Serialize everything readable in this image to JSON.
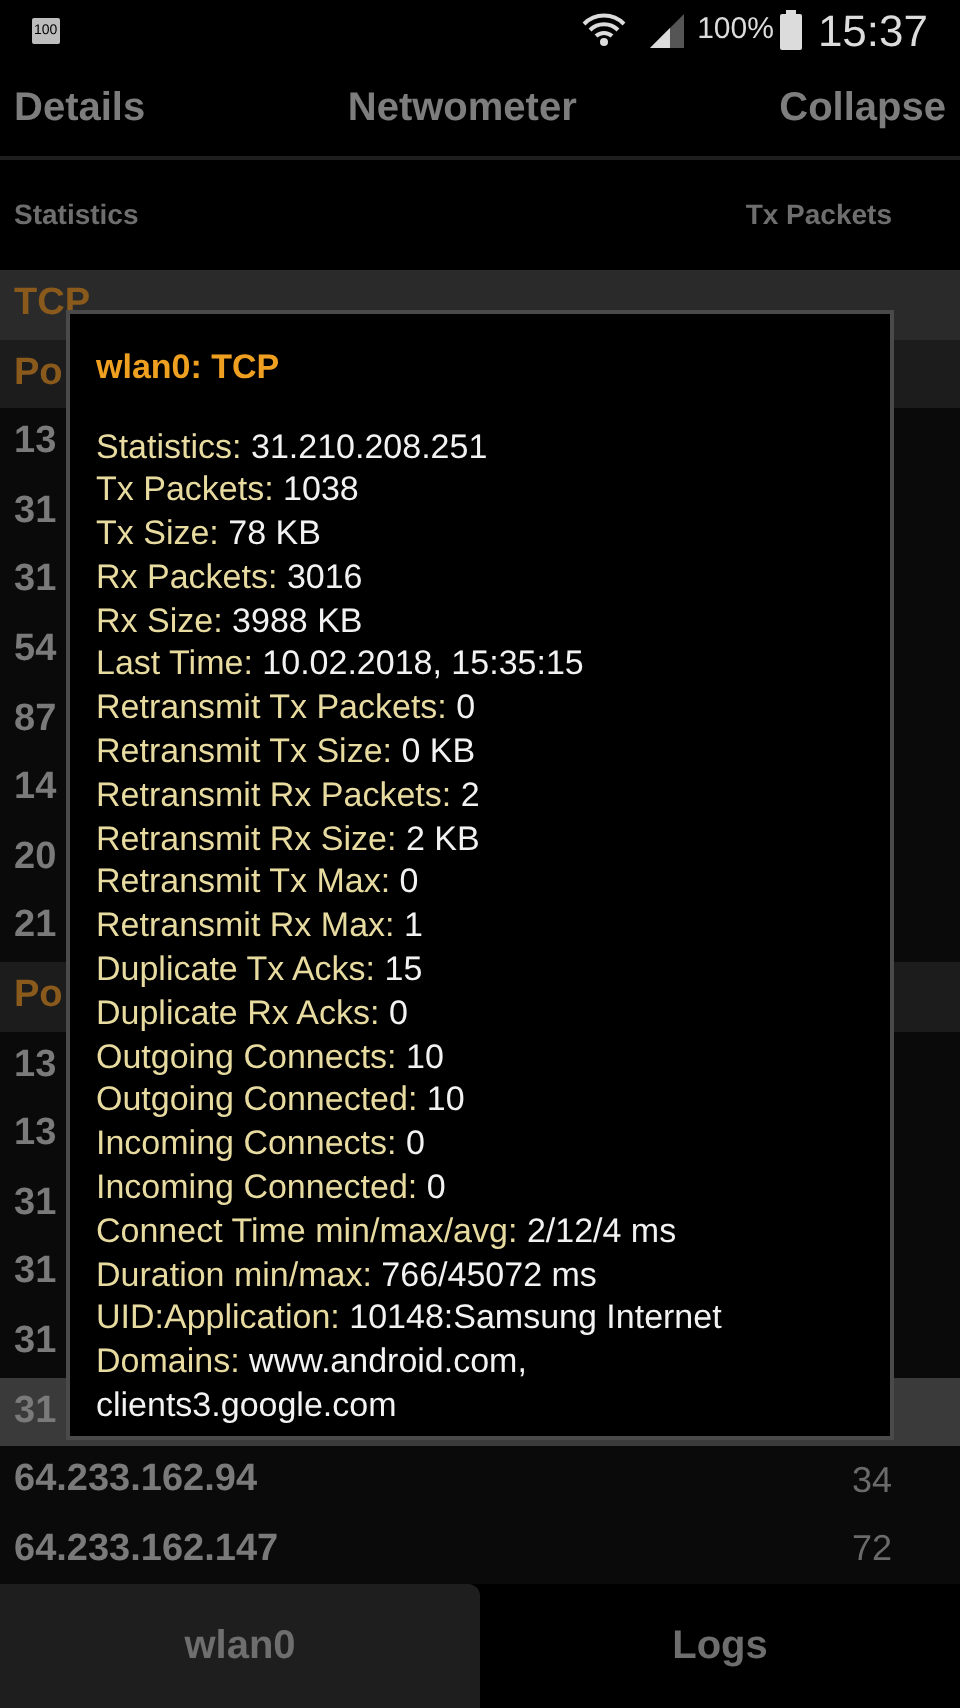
{
  "status_bar": {
    "notification": "100",
    "battery_percent": "100%",
    "time": "15:37"
  },
  "app_bar": {
    "left": "Details",
    "title": "Netwometer",
    "right": "Collapse"
  },
  "columns": [
    "Statistics",
    "Tx Packets"
  ],
  "rows": [
    {
      "kind": "group",
      "label": "TCP",
      "selected": true
    },
    {
      "kind": "group",
      "label": "Po",
      "selected": false
    },
    {
      "kind": "item",
      "label": "13",
      "selected": false
    },
    {
      "kind": "item",
      "label": "31",
      "selected": false
    },
    {
      "kind": "item",
      "label": "31",
      "selected": false
    },
    {
      "kind": "item",
      "label": "54",
      "selected": false
    },
    {
      "kind": "item",
      "label": "87",
      "selected": false
    },
    {
      "kind": "item",
      "label": "14",
      "selected": false
    },
    {
      "kind": "item",
      "label": "20",
      "selected": false
    },
    {
      "kind": "item",
      "label": "21",
      "selected": false
    },
    {
      "kind": "group",
      "label": "Po",
      "selected": false
    },
    {
      "kind": "item",
      "label": "13",
      "selected": false
    },
    {
      "kind": "item",
      "label": "13",
      "selected": false
    },
    {
      "kind": "item",
      "label": "31",
      "selected": false
    },
    {
      "kind": "item",
      "label": "31",
      "selected": false
    },
    {
      "kind": "item",
      "label": "31",
      "selected": false
    },
    {
      "kind": "item",
      "label": "31",
      "selected": true
    },
    {
      "kind": "item",
      "label": "64.233.162.94",
      "value": "34",
      "selected": false
    },
    {
      "kind": "item",
      "label": "64.233.162.147",
      "value": "72",
      "selected": false
    }
  ],
  "dialog": {
    "title": "wlan0: TCP",
    "lines": [
      {
        "label": "Statistics:",
        "value": "31.210.208.251"
      },
      {
        "label": "Tx Packets:",
        "value": "1038"
      },
      {
        "label": "Tx Size:",
        "value": "78 KB"
      },
      {
        "label": "Rx Packets:",
        "value": "3016"
      },
      {
        "label": "Rx Size:",
        "value": "3988 KB"
      },
      {
        "label": "Last Time:",
        "value": "10.02.2018, 15:35:15"
      },
      {
        "label": "Retransmit Tx Packets:",
        "value": "0"
      },
      {
        "label": "Retransmit Tx Size:",
        "value": "0 KB"
      },
      {
        "label": "Retransmit Rx Packets:",
        "value": "2"
      },
      {
        "label": "Retransmit Rx Size:",
        "value": "2 KB"
      },
      {
        "label": "Retransmit Tx Max:",
        "value": "0"
      },
      {
        "label": "Retransmit Rx Max:",
        "value": "1"
      },
      {
        "label": "Duplicate Tx Acks:",
        "value": "15"
      },
      {
        "label": "Duplicate Rx Acks:",
        "value": "0"
      },
      {
        "label": "Outgoing Connects:",
        "value": "10"
      },
      {
        "label": "Outgoing Connected:",
        "value": "10"
      },
      {
        "label": "Incoming Connects:",
        "value": "0"
      },
      {
        "label": "Incoming Connected:",
        "value": "0"
      },
      {
        "label": "Connect Time min/max/avg:",
        "value": "2/12/4 ms"
      },
      {
        "label": "Duration min/max:",
        "value": "766/45072 ms"
      },
      {
        "label": "UID:Application:",
        "value": "10148:Samsung Internet"
      },
      {
        "label": "Domains:",
        "value": "www.android.com,\nclients3.google.com"
      }
    ]
  },
  "tabs": [
    {
      "label": "wlan0",
      "selected": true
    },
    {
      "label": "Logs",
      "selected": false
    }
  ]
}
